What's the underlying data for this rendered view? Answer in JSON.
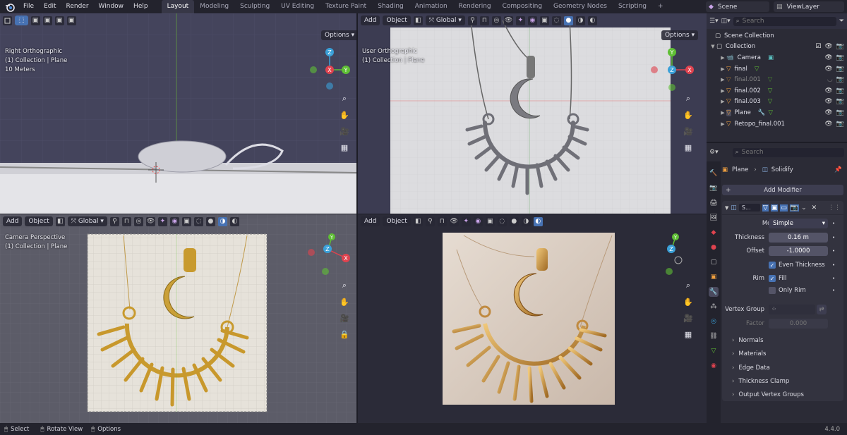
{
  "topbar": {
    "menus": [
      "File",
      "Edit",
      "Render",
      "Window",
      "Help"
    ],
    "workspaces": [
      "Layout",
      "Modeling",
      "Sculpting",
      "UV Editing",
      "Texture Paint",
      "Shading",
      "Animation",
      "Rendering",
      "Compositing",
      "Geometry Nodes",
      "Scripting"
    ],
    "add_tab": "+",
    "scene": "Scene",
    "view_layer": "ViewLayer"
  },
  "viewport_header": {
    "add": "Add",
    "object": "Object",
    "transform_orientation": "Global",
    "options": "Options"
  },
  "viewports": {
    "right_ortho": {
      "line1": "Right Orthographic",
      "line2": "(1) Collection | Plane",
      "line3": "10 Meters"
    },
    "user_ortho": {
      "line1": "User Orthographic",
      "line2": "(1) Collection | Plane"
    },
    "camera_persp": {
      "line1": "Camera Perspective",
      "line2": "(1) Collection | Plane"
    }
  },
  "gizmo_labels": {
    "z": "Z",
    "x": "X",
    "y": "Y"
  },
  "outliner": {
    "search_placeholder": "Search",
    "root": "Scene Collection",
    "collection": "Collection",
    "items": [
      "Camera",
      "final",
      "final.001",
      "final.002",
      "final.003",
      "Plane",
      "Retopo_final.001"
    ]
  },
  "properties": {
    "search_placeholder": "Search",
    "breadcrumb_object": "Plane",
    "breadcrumb_modifier": "Solidify",
    "add_modifier": "Add Modifier",
    "modifier_name": "S...",
    "mode_label": "Mode",
    "mode_value": "Simple",
    "thickness_label": "Thickness",
    "thickness_value": "0.16 m",
    "offset_label": "Offset",
    "offset_value": "-1.0000",
    "even_thickness": "Even Thickness",
    "rim_label": "Rim",
    "fill": "Fill",
    "only_rim": "Only Rim",
    "vertex_group_label": "Vertex Group",
    "factor_label": "Factor",
    "factor_value": "0.000",
    "subpanels": [
      "Normals",
      "Materials",
      "Edge Data",
      "Thickness Clamp",
      "Output Vertex Groups"
    ]
  },
  "statusbar": {
    "select": "Select",
    "rotate": "Rotate View",
    "options": "Options",
    "version": "4.4.0"
  },
  "colors": {
    "axis_x": "#e0434f",
    "axis_y": "#5fbf35",
    "axis_z": "#3aa0d8",
    "accent": "#4772b3",
    "gold": "#c89a2e"
  }
}
